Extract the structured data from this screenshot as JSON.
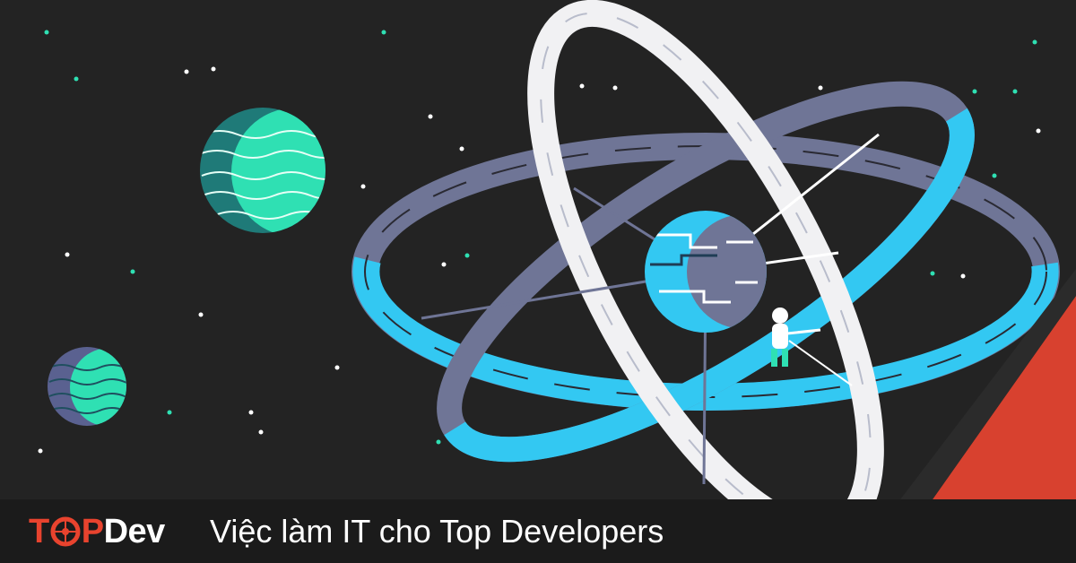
{
  "brand": {
    "part1": "T",
    "part2": "P",
    "part3": "Dev",
    "accent_color": "#e8432e"
  },
  "tagline": "Việc làm IT cho Top Developers",
  "illustration": {
    "subject": "atom-orbits-illustration",
    "colors": {
      "background": "#232323",
      "orbit_slate": "#6f7596",
      "orbit_cyan": "#33c8f2",
      "orbit_white": "#f1f1f3",
      "planet_teal": "#2fe0b3",
      "planet_dark_teal": "#1f7a78",
      "red_corner": "#d8412f"
    }
  }
}
